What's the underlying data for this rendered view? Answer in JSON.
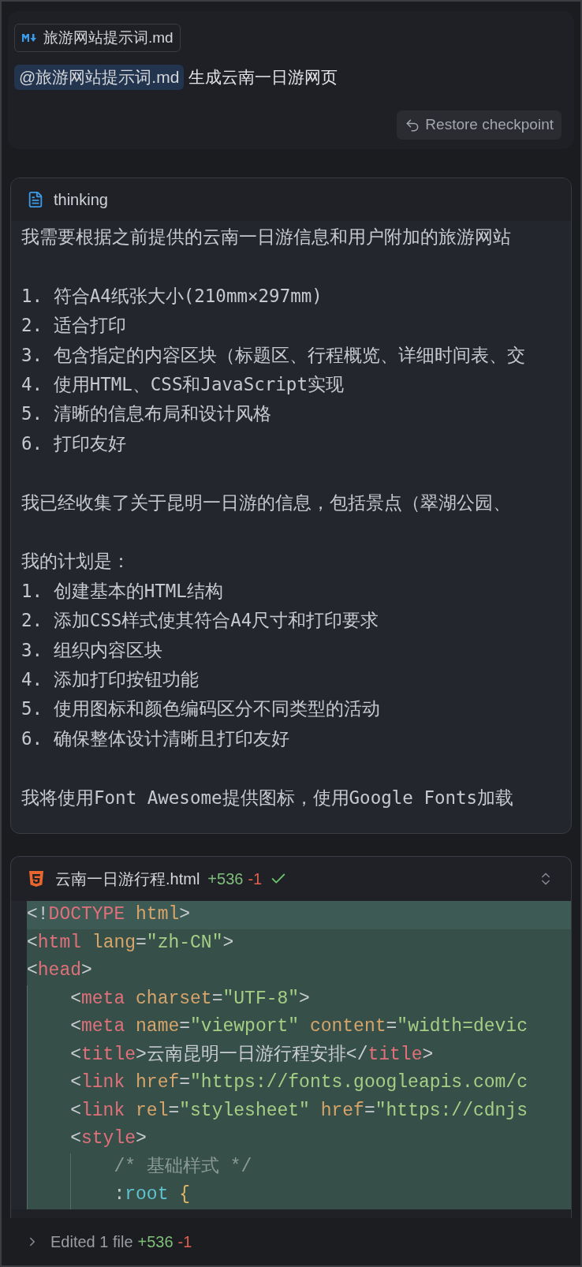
{
  "user_message": {
    "attachment": {
      "name": "旅游网站提示词.md"
    },
    "mention": "@旅游网站提示词.md",
    "text": "生成云南一日游网页",
    "restore_button": "Restore checkpoint"
  },
  "thinking": {
    "title": "thinking",
    "blocks": [
      {
        "lines": [
          "我需要根据之前提供的云南一日游信息和用户附加的旅游网站"
        ]
      },
      {
        "lines": [
          "1. 符合A4纸张大小(210mm×297mm)",
          "2. 适合打印",
          "3. 包含指定的内容区块（标题区、行程概览、详细时间表、交",
          "4. 使用HTML、CSS和JavaScript实现",
          "5. 清晰的信息布局和设计风格",
          "6. 打印友好"
        ]
      },
      {
        "lines": [
          "我已经收集了关于昆明一日游的信息，包括景点（翠湖公园、"
        ]
      },
      {
        "lines": [
          "我的计划是：",
          "1. 创建基本的HTML结构",
          "2. 添加CSS样式使其符合A4尺寸和打印要求",
          "3. 组织内容区块",
          "4. 添加打印按钮功能",
          "5. 使用图标和颜色编码区分不同类型的活动",
          "6. 确保整体设计清晰且打印友好"
        ]
      },
      {
        "lines": [
          "我将使用Font Awesome提供图标，使用Google Fonts加载"
        ]
      }
    ]
  },
  "code_file": {
    "name": "云南一日游行程.html",
    "added": "+536",
    "removed": "-1",
    "applied": true,
    "lines": [
      {
        "current": true,
        "tokens": [
          {
            "kind": "punct",
            "text": "<!"
          },
          {
            "kind": "tag",
            "text": "DOCTYPE"
          },
          {
            "kind": "attr",
            "text": " html"
          },
          {
            "kind": "punct",
            "text": ">"
          }
        ]
      },
      {
        "current": false,
        "tokens": [
          {
            "kind": "punct",
            "text": "<"
          },
          {
            "kind": "tag",
            "text": "html"
          },
          {
            "kind": "attr",
            "text": " lang"
          },
          {
            "kind": "punct",
            "text": "="
          },
          {
            "kind": "string",
            "text": "\"zh-CN\""
          },
          {
            "kind": "punct",
            "text": ">"
          }
        ]
      },
      {
        "current": false,
        "tokens": [
          {
            "kind": "punct",
            "text": "<"
          },
          {
            "kind": "tag",
            "text": "head"
          },
          {
            "kind": "punct",
            "text": ">"
          }
        ]
      },
      {
        "current": false,
        "tokens": [
          {
            "kind": "punct",
            "text": "    <"
          },
          {
            "kind": "tag",
            "text": "meta"
          },
          {
            "kind": "attr",
            "text": " charset"
          },
          {
            "kind": "punct",
            "text": "="
          },
          {
            "kind": "string",
            "text": "\"UTF-8\""
          },
          {
            "kind": "punct",
            "text": ">"
          }
        ]
      },
      {
        "current": false,
        "tokens": [
          {
            "kind": "punct",
            "text": "    <"
          },
          {
            "kind": "tag",
            "text": "meta"
          },
          {
            "kind": "attr",
            "text": " name"
          },
          {
            "kind": "punct",
            "text": "="
          },
          {
            "kind": "string",
            "text": "\"viewport\""
          },
          {
            "kind": "attr",
            "text": " content"
          },
          {
            "kind": "punct",
            "text": "="
          },
          {
            "kind": "string",
            "text": "\"width=devic"
          }
        ]
      },
      {
        "current": false,
        "tokens": [
          {
            "kind": "punct",
            "text": "    <"
          },
          {
            "kind": "tag",
            "text": "title"
          },
          {
            "kind": "punct",
            "text": ">"
          },
          {
            "kind": "text",
            "text": "云南昆明一日游行程安排"
          },
          {
            "kind": "punct",
            "text": "</"
          },
          {
            "kind": "tag",
            "text": "title"
          },
          {
            "kind": "punct",
            "text": ">"
          }
        ]
      },
      {
        "current": false,
        "tokens": [
          {
            "kind": "punct",
            "text": "    <"
          },
          {
            "kind": "tag",
            "text": "link"
          },
          {
            "kind": "attr",
            "text": " href"
          },
          {
            "kind": "punct",
            "text": "="
          },
          {
            "kind": "string",
            "text": "\"https://fonts.googleapis.com/c"
          }
        ]
      },
      {
        "current": false,
        "tokens": [
          {
            "kind": "punct",
            "text": "    <"
          },
          {
            "kind": "tag",
            "text": "link"
          },
          {
            "kind": "attr",
            "text": " rel"
          },
          {
            "kind": "punct",
            "text": "="
          },
          {
            "kind": "string",
            "text": "\"stylesheet\""
          },
          {
            "kind": "attr",
            "text": " href"
          },
          {
            "kind": "punct",
            "text": "="
          },
          {
            "kind": "string",
            "text": "\"https://cdnjs"
          }
        ]
      },
      {
        "current": false,
        "tokens": [
          {
            "kind": "punct",
            "text": "    <"
          },
          {
            "kind": "tag",
            "text": "style"
          },
          {
            "kind": "punct",
            "text": ">"
          }
        ]
      },
      {
        "current": false,
        "tokens": [
          {
            "kind": "comment",
            "text": "        /* 基础样式 */"
          }
        ]
      },
      {
        "current": false,
        "tokens": [
          {
            "kind": "punct",
            "text": "        :"
          },
          {
            "kind": "selector",
            "text": "root"
          },
          {
            "kind": "brace",
            "text": " {"
          }
        ]
      }
    ]
  },
  "status_bar": {
    "label": "Edited 1 file",
    "added": "+536",
    "removed": "-1"
  }
}
